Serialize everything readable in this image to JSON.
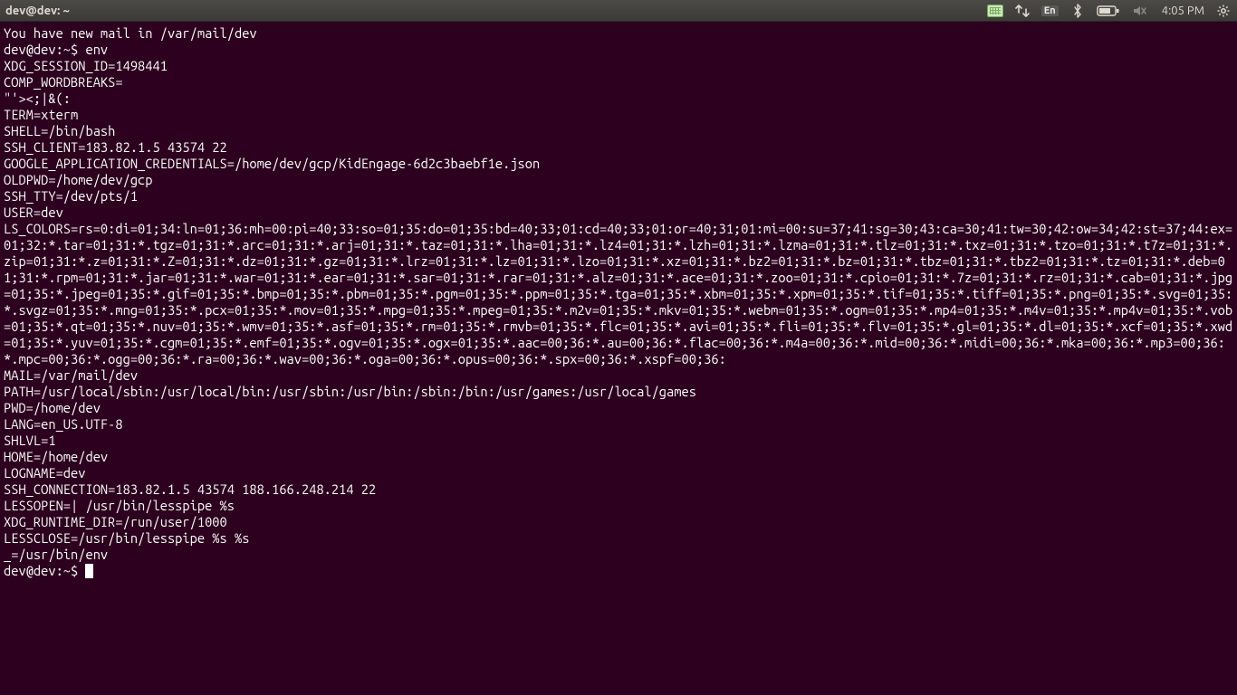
{
  "menubar": {
    "title": "dev@dev: ~",
    "lang": "En",
    "clock": "4:05 PM"
  },
  "terminal": {
    "lines": [
      "You have new mail in /var/mail/dev",
      "dev@dev:~$ env",
      "XDG_SESSION_ID=1498441",
      "COMP_WORDBREAKS= ",
      "\"'><;|&(:",
      "TERM=xterm",
      "SHELL=/bin/bash",
      "SSH_CLIENT=183.82.1.5 43574 22",
      "GOOGLE_APPLICATION_CREDENTIALS=/home/dev/gcp/KidEngage-6d2c3baebf1e.json",
      "OLDPWD=/home/dev/gcp",
      "SSH_TTY=/dev/pts/1",
      "USER=dev",
      "LS_COLORS=rs=0:di=01;34:ln=01;36:mh=00:pi=40;33:so=01;35:do=01;35:bd=40;33;01:cd=40;33;01:or=40;31;01:mi=00:su=37;41:sg=30;43:ca=30;41:tw=30;42:ow=34;42:st=37;44:ex=01;32:*.tar=01;31:*.tgz=01;31:*.arc=01;31:*.arj=01;31:*.taz=01;31:*.lha=01;31:*.lz4=01;31:*.lzh=01;31:*.lzma=01;31:*.tlz=01;31:*.txz=01;31:*.tzo=01;31:*.t7z=01;31:*.zip=01;31:*.z=01;31:*.Z=01;31:*.dz=01;31:*.gz=01;31:*.lrz=01;31:*.lz=01;31:*.lzo=01;31:*.xz=01;31:*.bz2=01;31:*.bz=01;31:*.tbz=01;31:*.tbz2=01;31:*.tz=01;31:*.deb=01;31:*.rpm=01;31:*.jar=01;31:*.war=01;31:*.ear=01;31:*.sar=01;31:*.rar=01;31:*.alz=01;31:*.ace=01;31:*.zoo=01;31:*.cpio=01;31:*.7z=01;31:*.rz=01;31:*.cab=01;31:*.jpg=01;35:*.jpeg=01;35:*.gif=01;35:*.bmp=01;35:*.pbm=01;35:*.pgm=01;35:*.ppm=01;35:*.tga=01;35:*.xbm=01;35:*.xpm=01;35:*.tif=01;35:*.tiff=01;35:*.png=01;35:*.svg=01;35:*.svgz=01;35:*.mng=01;35:*.pcx=01;35:*.mov=01;35:*.mpg=01;35:*.mpeg=01;35:*.m2v=01;35:*.mkv=01;35:*.webm=01;35:*.ogm=01;35:*.mp4=01;35:*.m4v=01;35:*.mp4v=01;35:*.vob=01;35:*.qt=01;35:*.nuv=01;35:*.wmv=01;35:*.asf=01;35:*.rm=01;35:*.rmvb=01;35:*.flc=01;35:*.avi=01;35:*.fli=01;35:*.flv=01;35:*.gl=01;35:*.dl=01;35:*.xcf=01;35:*.xwd=01;35:*.yuv=01;35:*.cgm=01;35:*.emf=01;35:*.ogv=01;35:*.ogx=01;35:*.aac=00;36:*.au=00;36:*.flac=00;36:*.m4a=00;36:*.mid=00;36:*.midi=00;36:*.mka=00;36:*.mp3=00;36:*.mpc=00;36:*.ogg=00;36:*.ra=00;36:*.wav=00;36:*.oga=00;36:*.opus=00;36:*.spx=00;36:*.xspf=00;36:",
      "MAIL=/var/mail/dev",
      "PATH=/usr/local/sbin:/usr/local/bin:/usr/sbin:/usr/bin:/sbin:/bin:/usr/games:/usr/local/games",
      "PWD=/home/dev",
      "LANG=en_US.UTF-8",
      "SHLVL=1",
      "HOME=/home/dev",
      "LOGNAME=dev",
      "SSH_CONNECTION=183.82.1.5 43574 188.166.248.214 22",
      "LESSOPEN=| /usr/bin/lesspipe %s",
      "XDG_RUNTIME_DIR=/run/user/1000",
      "LESSCLOSE=/usr/bin/lesspipe %s %s",
      "_=/usr/bin/env"
    ],
    "prompt": "dev@dev:~$ "
  }
}
